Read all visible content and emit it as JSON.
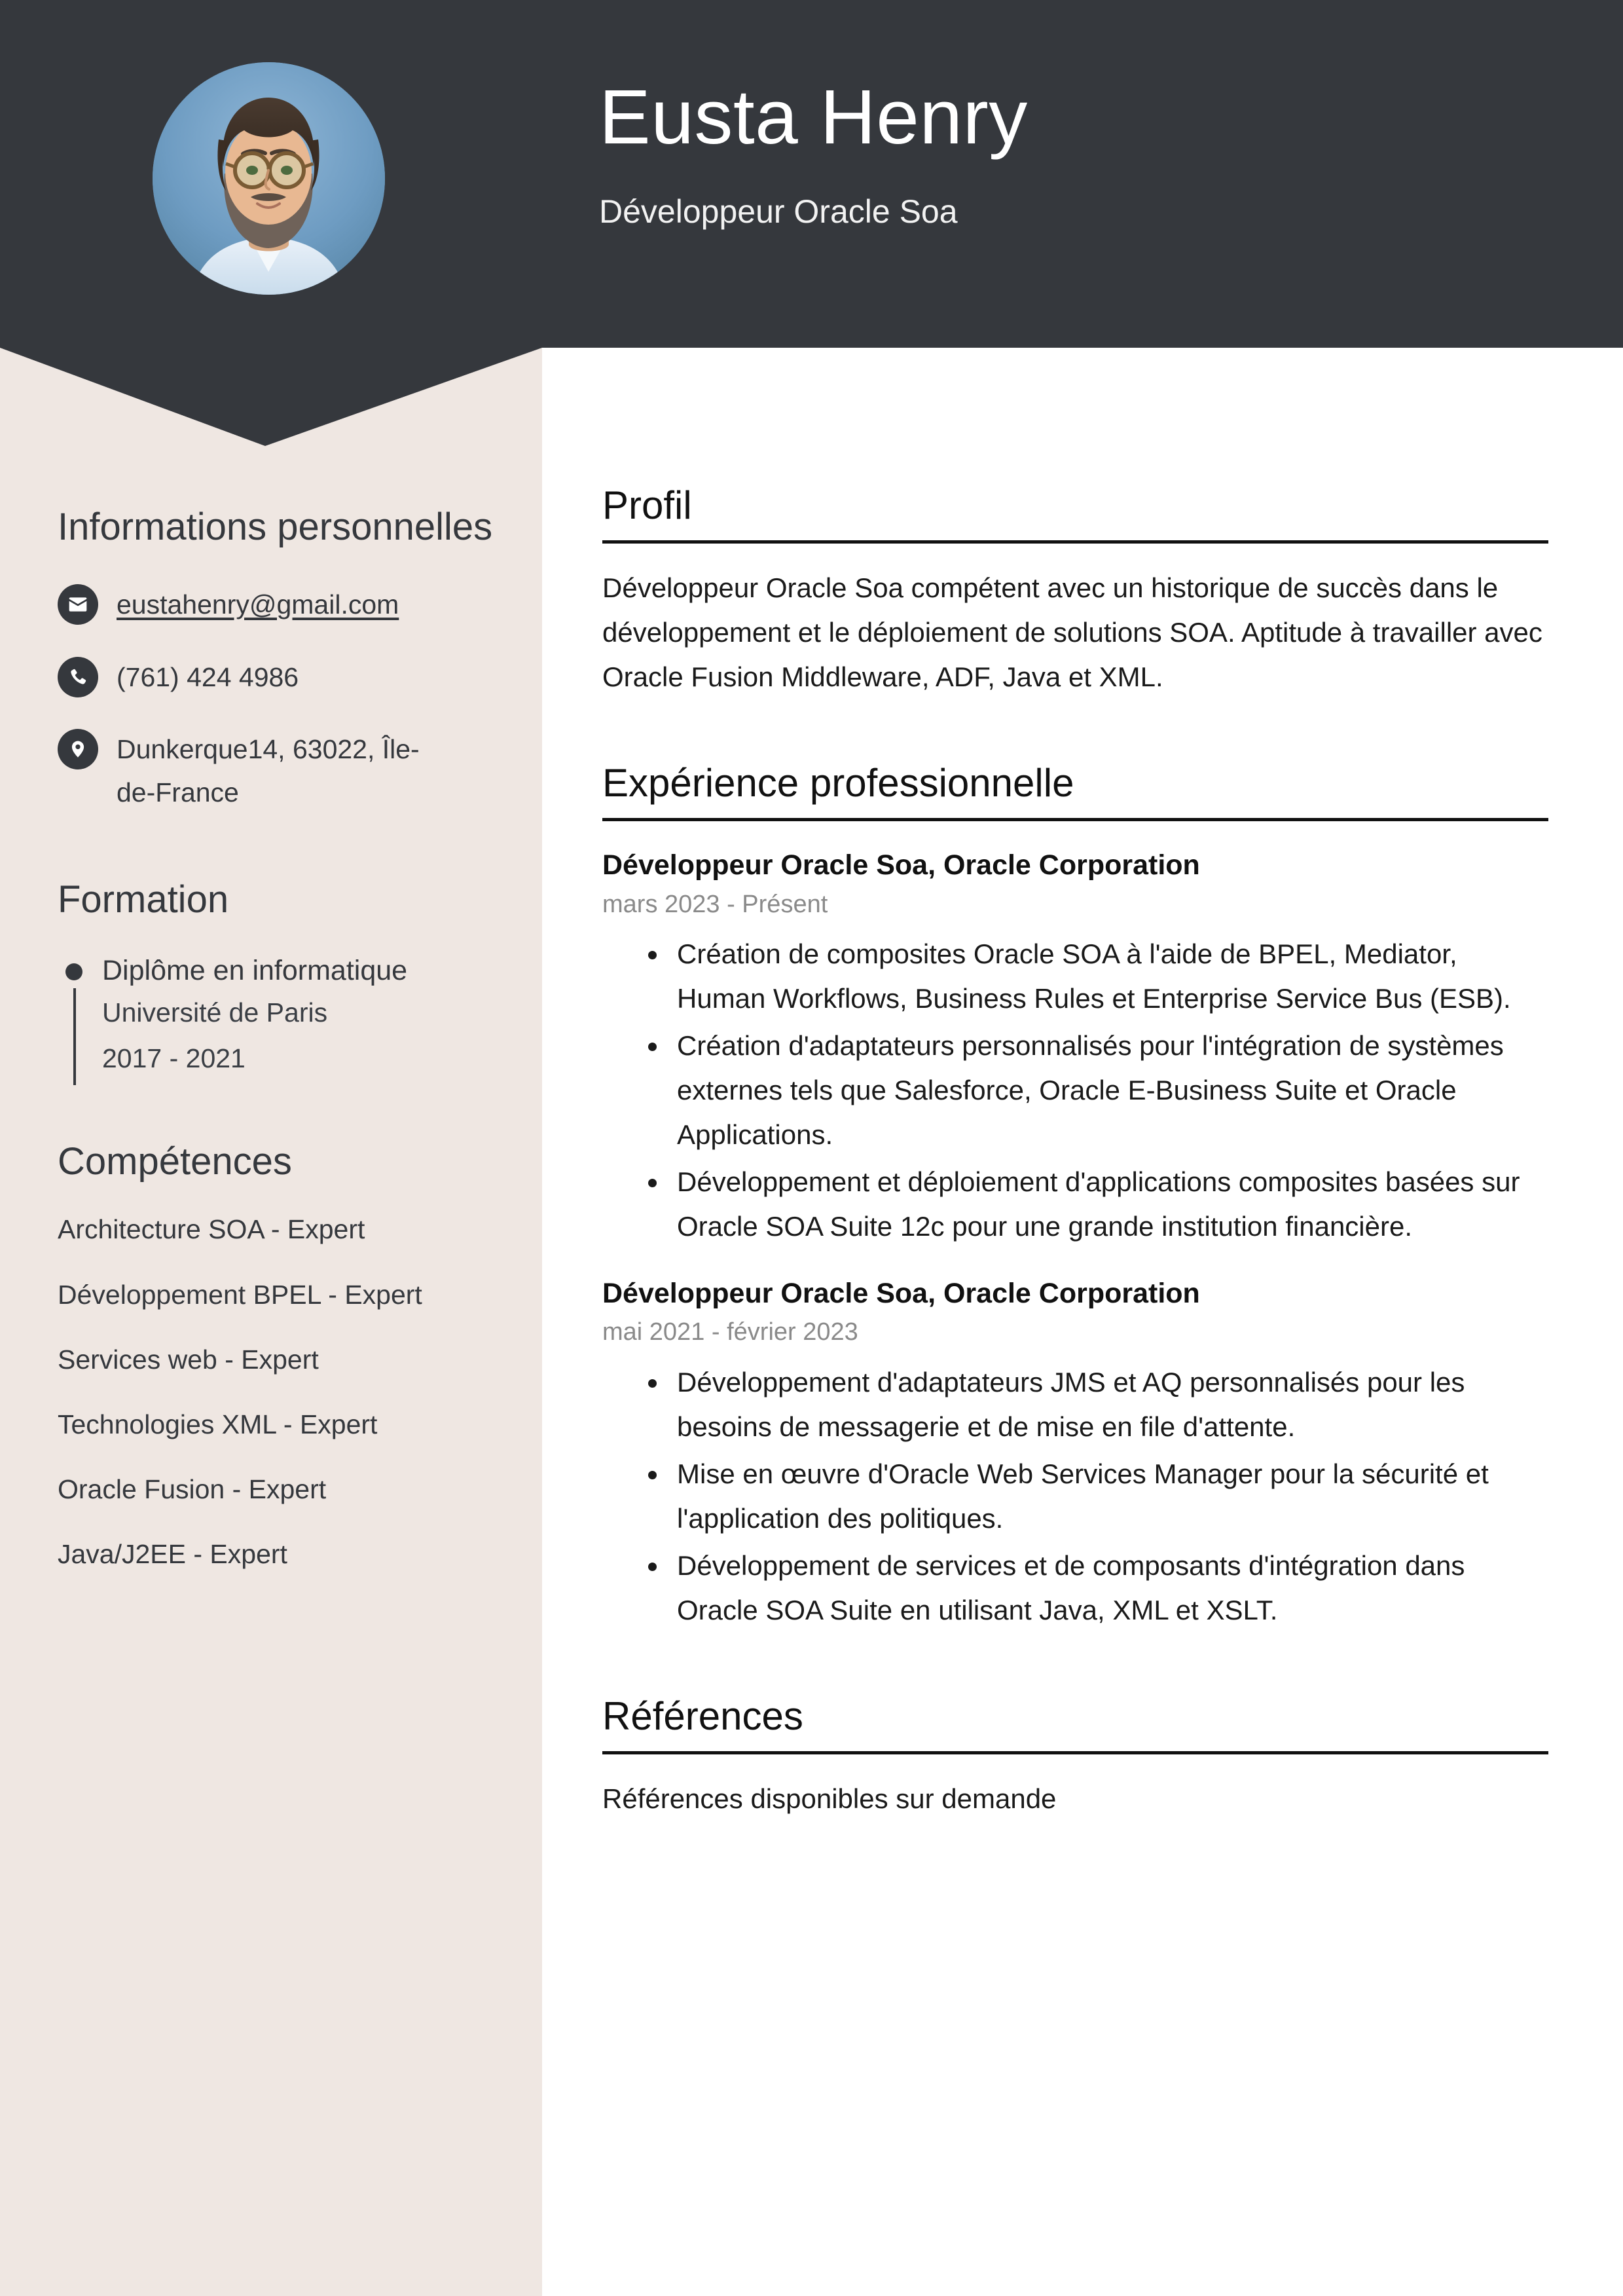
{
  "header": {
    "name": "Eusta Henry",
    "job_title": "Développeur Oracle Soa",
    "bg_color": "#35383D",
    "avatar_alt": "profile-photo"
  },
  "sidebar": {
    "bg_color": "#EFE7E2",
    "personal_info": {
      "heading": "Informations personnelles",
      "items": [
        {
          "icon": "envelope-icon",
          "value": "eustahenry@gmail.com",
          "is_link": true
        },
        {
          "icon": "phone-icon",
          "value": "(761) 424 4986",
          "is_link": false
        },
        {
          "icon": "location-pin-icon",
          "value": "Dunkerque14, 63022, Île-de-France",
          "is_link": false
        }
      ]
    },
    "education": {
      "heading": "Formation",
      "items": [
        {
          "degree": "Diplôme en informatique",
          "school": "Université de Paris",
          "dates": "2017 - 2021"
        }
      ]
    },
    "skills": {
      "heading": "Compétences",
      "items": [
        "Architecture SOA - Expert",
        "Développement BPEL - Expert",
        "Services web - Expert",
        "Technologies XML - Expert",
        "Oracle Fusion - Expert",
        "Java/J2EE - Expert"
      ]
    }
  },
  "main": {
    "profile": {
      "heading": "Profil",
      "text": "Développeur Oracle Soa compétent avec un historique de succès dans le développement et le déploiement de solutions SOA. Aptitude à travailler avec Oracle Fusion Middleware, ADF, Java et XML."
    },
    "experience": {
      "heading": "Expérience professionnelle",
      "jobs": [
        {
          "role": "Développeur Oracle Soa, Oracle Corporation",
          "dates": "mars 2023 - Présent",
          "bullets": [
            "Création de composites Oracle SOA à l'aide de BPEL, Mediator, Human Workflows, Business Rules et Enterprise Service Bus (ESB).",
            "Création d'adaptateurs personnalisés pour l'intégration de systèmes externes tels que Salesforce, Oracle E-Business Suite et Oracle Applications.",
            "Développement et déploiement d'applications composites basées sur Oracle SOA Suite 12c pour une grande institution financière."
          ]
        },
        {
          "role": "Développeur Oracle Soa, Oracle Corporation",
          "dates": "mai 2021 - février 2023",
          "bullets": [
            "Développement d'adaptateurs JMS et AQ personnalisés pour les besoins de messagerie et de mise en file d'attente.",
            "Mise en œuvre d'Oracle Web Services Manager pour la sécurité et l'application des politiques.",
            "Développement de services et de composants d'intégration dans Oracle SOA Suite en utilisant Java, XML et XSLT."
          ]
        }
      ]
    },
    "references": {
      "heading": "Références",
      "text": "Références disponibles sur demande"
    }
  }
}
